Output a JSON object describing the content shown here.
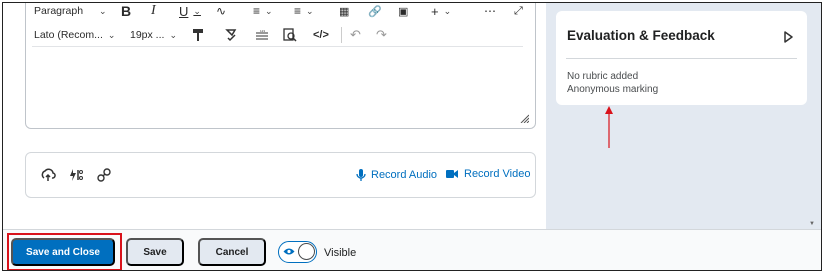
{
  "toolbar": {
    "format_label": "Paragraph",
    "font_label": "Lato (Recom...",
    "size_label": "19px ..."
  },
  "attachments": {
    "record_audio_label": "Record Audio",
    "record_video_label": "Record Video"
  },
  "side_panel": {
    "title": "Evaluation & Feedback",
    "rubric_text": "No rubric added",
    "marking_text": "Anonymous marking"
  },
  "footer": {
    "save_close_label": "Save and Close",
    "save_label": "Save",
    "cancel_label": "Cancel",
    "visible_label": "Visible",
    "visible_on": true
  },
  "colors": {
    "primary": "#006fbf",
    "annotation_red": "#d9121b",
    "side_bg": "#e3e9f1"
  }
}
